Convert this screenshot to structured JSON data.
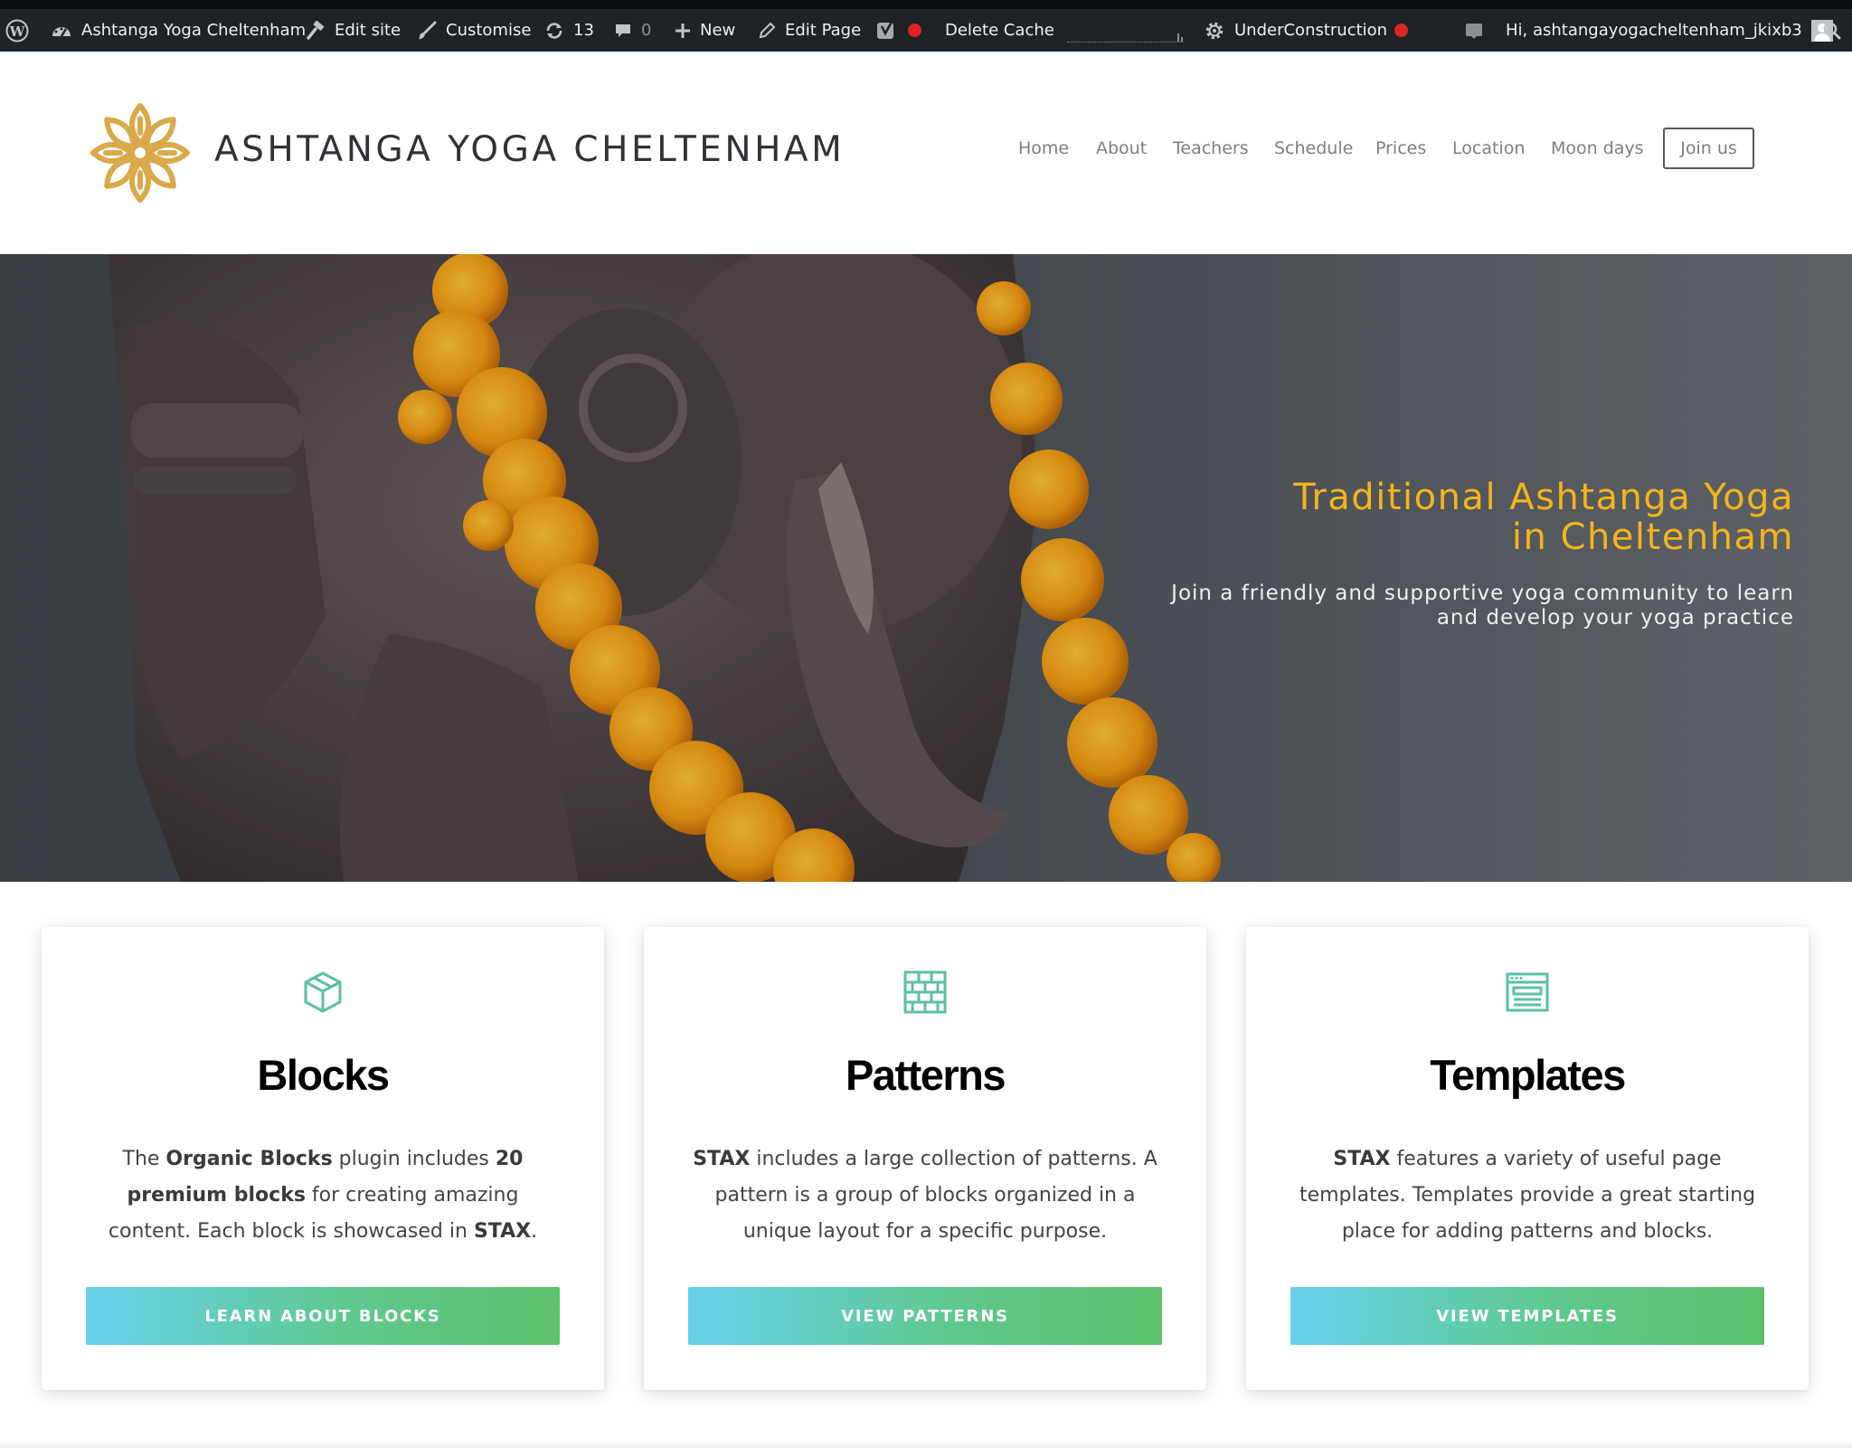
{
  "admin_bar": {
    "site_name": "Ashtanga Yoga Cheltenham",
    "edit_site": "Edit site",
    "customise": "Customise",
    "updates_count": "13",
    "comments_count": "0",
    "new": "New",
    "edit_page": "Edit Page",
    "delete_cache": "Delete Cache",
    "under_construction": "UnderConstruction",
    "greeting": "Hi, ashtangayogacheltenham_jkixb3",
    "icons": [
      "wordpress-logo-icon",
      "dashboard-icon",
      "hammer-icon",
      "brush-icon",
      "refresh-icon",
      "comment-icon",
      "plus-icon",
      "pencil-icon",
      "yoast-icon",
      "gear-icon",
      "notification-icon",
      "avatar",
      "search-icon"
    ],
    "status_dot_color": "#e02424"
  },
  "header": {
    "site_title": "ASHTANGA YOGA CHELTENHAM",
    "logo_color": "#d9a94a",
    "nav": [
      "Home",
      "About",
      "Teachers",
      "Schedule",
      "Prices",
      "Location",
      "Moon days"
    ],
    "cta": "Join us"
  },
  "hero": {
    "title_line1": "Traditional Ashtanga Yoga",
    "title_line2": "in Cheltenham",
    "subtitle_line1": "Join a friendly and supportive yoga community to learn",
    "subtitle_line2": "and develop your yoga practice",
    "title_color": "#f4b41a"
  },
  "cards": [
    {
      "icon": "cube-icon",
      "title": "Blocks",
      "text_parts": [
        "The ",
        "Organic Blocks",
        " plugin includes ",
        "20 premium blocks",
        " for creating amazing content. Each block is showcased in ",
        "STAX",
        "."
      ],
      "button": "LEARN ABOUT BLOCKS"
    },
    {
      "icon": "brick-wall-icon",
      "title": "Patterns",
      "text_parts": [
        "STAX",
        " includes a large collection of patterns. A pattern is a group of blocks organized in a unique layout for a specific purpose."
      ],
      "button": "VIEW PATTERNS"
    },
    {
      "icon": "browser-window-icon",
      "title": "Templates",
      "text_parts": [
        "STAX",
        " features a variety of useful page templates. Templates provide a great starting place for adding patterns and blocks."
      ],
      "button": "VIEW TEMPLATES"
    }
  ],
  "colors": {
    "admin_bar_bg": "#1d2327",
    "icon_teal": "#5bbfa6",
    "button_gradient_start": "#67d1ed",
    "button_gradient_end": "#5cc16c"
  }
}
